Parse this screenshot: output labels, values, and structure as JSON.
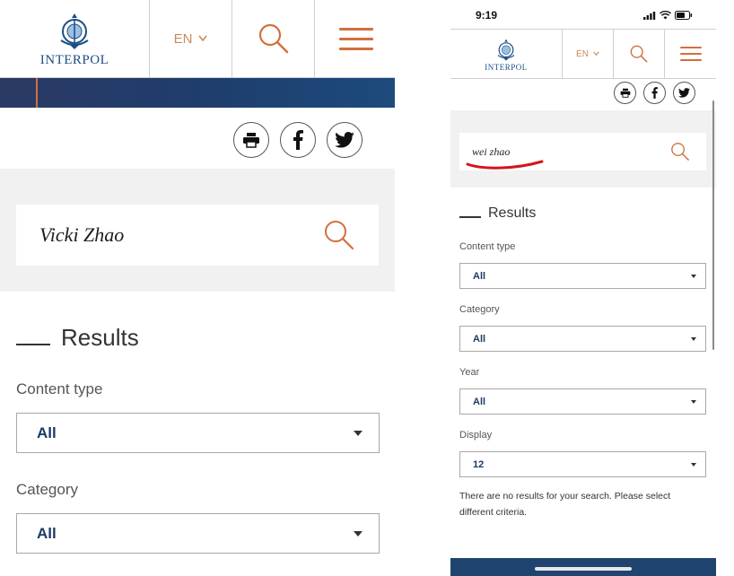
{
  "left": {
    "logo_text": "INTERPOL",
    "language": "EN",
    "search": {
      "query": "Vicki Zhao"
    },
    "results_title": "Results",
    "filters": [
      {
        "label": "Content type",
        "value": "All"
      },
      {
        "label": "Category",
        "value": "All"
      }
    ]
  },
  "right": {
    "status": {
      "time": "9:19"
    },
    "logo_text": "INTERPOL",
    "language": "EN",
    "search": {
      "query": "wei zhao"
    },
    "results_title": "Results",
    "filters": [
      {
        "label": "Content type",
        "value": "All"
      },
      {
        "label": "Category",
        "value": "All"
      },
      {
        "label": "Year",
        "value": "All"
      },
      {
        "label": "Display",
        "value": "12"
      }
    ],
    "no_results_message": "There are no results for your search. Please select different criteria."
  },
  "colors": {
    "accent": "#d26f3e",
    "brand_blue": "#1b4e86",
    "nav_band": "#1f4470",
    "annotation_red": "#d4141c"
  }
}
